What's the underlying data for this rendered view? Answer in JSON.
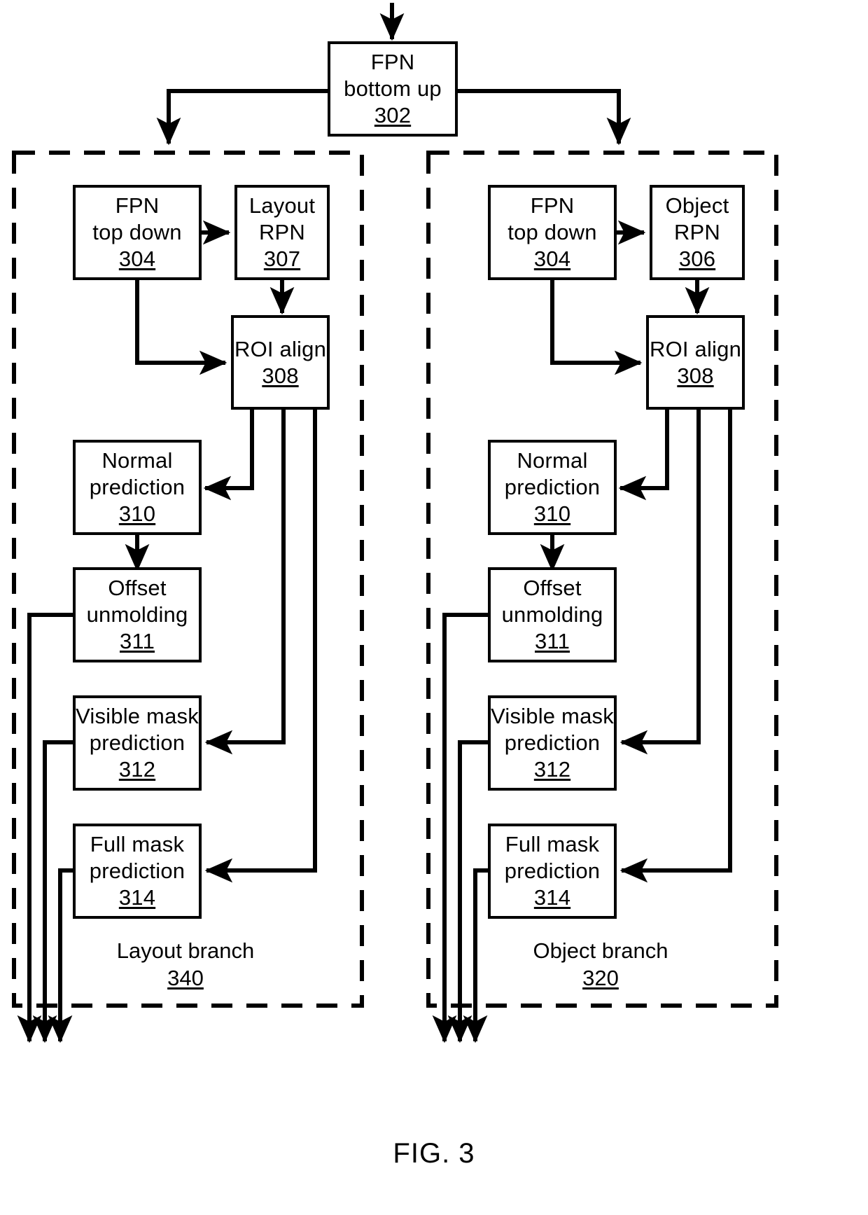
{
  "figure": {
    "caption": "FIG. 3",
    "stroke_color": "#000000",
    "background_color": "#ffffff"
  },
  "nodes": {
    "fpn_bottom_up": {
      "line1": "FPN",
      "line2": "bottom up",
      "ref": "302"
    },
    "left_fpn_top_down": {
      "line1": "FPN",
      "line2": "top down",
      "ref": "304"
    },
    "left_rpn": {
      "line1": "Layout",
      "line2": "RPN",
      "ref": "307"
    },
    "left_roi_align": {
      "line1": "ROI align",
      "ref": "308"
    },
    "left_normal_prediction": {
      "line1": "Normal",
      "line2": "prediction",
      "ref": "310"
    },
    "left_offset_unmolding": {
      "line1": "Offset",
      "line2": "unmolding",
      "ref": "311"
    },
    "left_visible_mask": {
      "line1": "Visible mask",
      "line2": "prediction",
      "ref": "312"
    },
    "left_full_mask": {
      "line1": "Full mask",
      "line2": "prediction",
      "ref": "314"
    },
    "right_fpn_top_down": {
      "line1": "FPN",
      "line2": "top down",
      "ref": "304"
    },
    "right_rpn": {
      "line1": "Object",
      "line2": "RPN",
      "ref": "306"
    },
    "right_roi_align": {
      "line1": "ROI align",
      "ref": "308"
    },
    "right_normal_prediction": {
      "line1": "Normal",
      "line2": "prediction",
      "ref": "310"
    },
    "right_offset_unmolding": {
      "line1": "Offset",
      "line2": "unmolding",
      "ref": "311"
    },
    "right_visible_mask": {
      "line1": "Visible mask",
      "line2": "prediction",
      "ref": "312"
    },
    "right_full_mask": {
      "line1": "Full mask",
      "line2": "prediction",
      "ref": "314"
    }
  },
  "branches": {
    "layout": {
      "label": "Layout branch",
      "ref": "340"
    },
    "object": {
      "label": "Object branch",
      "ref": "320"
    }
  }
}
